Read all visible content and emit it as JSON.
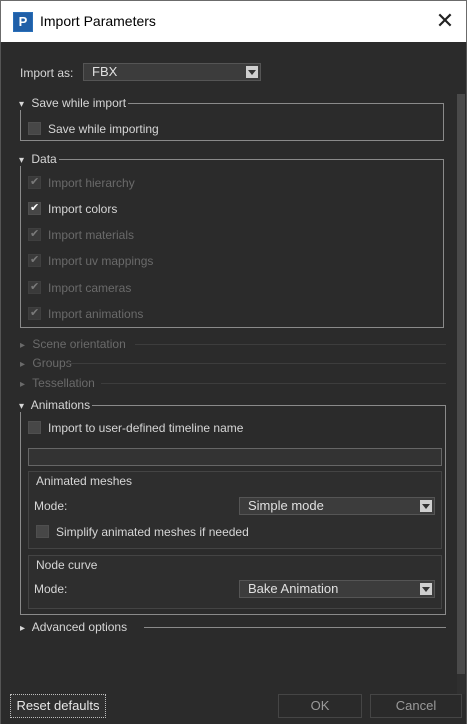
{
  "window": {
    "title": "Import Parameters",
    "icon_letter": "P",
    "close_glyph": "✕"
  },
  "import_as": {
    "label": "Import as:",
    "value": "FBX"
  },
  "save_section": {
    "title": "Save while import",
    "checkbox_label": "Save while importing",
    "checked": false
  },
  "data_section": {
    "title": "Data",
    "items": [
      {
        "label": "Import hierarchy",
        "checked": true,
        "enabled": false
      },
      {
        "label": "Import colors",
        "checked": true,
        "enabled": true
      },
      {
        "label": "Import materials",
        "checked": true,
        "enabled": false
      },
      {
        "label": "Import uv mappings",
        "checked": true,
        "enabled": false
      },
      {
        "label": "Import cameras",
        "checked": true,
        "enabled": false
      },
      {
        "label": "Import animations",
        "checked": true,
        "enabled": false
      }
    ]
  },
  "collapsed_sections": [
    "Scene orientation",
    "Groups",
    "Tessellation"
  ],
  "animations_section": {
    "title": "Animations",
    "timeline_checkbox_label": "Import to user-defined timeline name",
    "timeline_name_value": "",
    "animated_meshes": {
      "title": "Animated meshes",
      "mode_label": "Mode:",
      "mode_value": "Simple mode",
      "simplify_label": "Simplify animated meshes if needed"
    },
    "node_curve": {
      "title": "Node curve",
      "mode_label": "Mode:",
      "mode_value": "Bake Animation"
    }
  },
  "advanced_section": {
    "title": "Advanced options"
  },
  "footer": {
    "reset_label": "Reset defaults",
    "ok_label": "OK",
    "cancel_label": "Cancel"
  }
}
